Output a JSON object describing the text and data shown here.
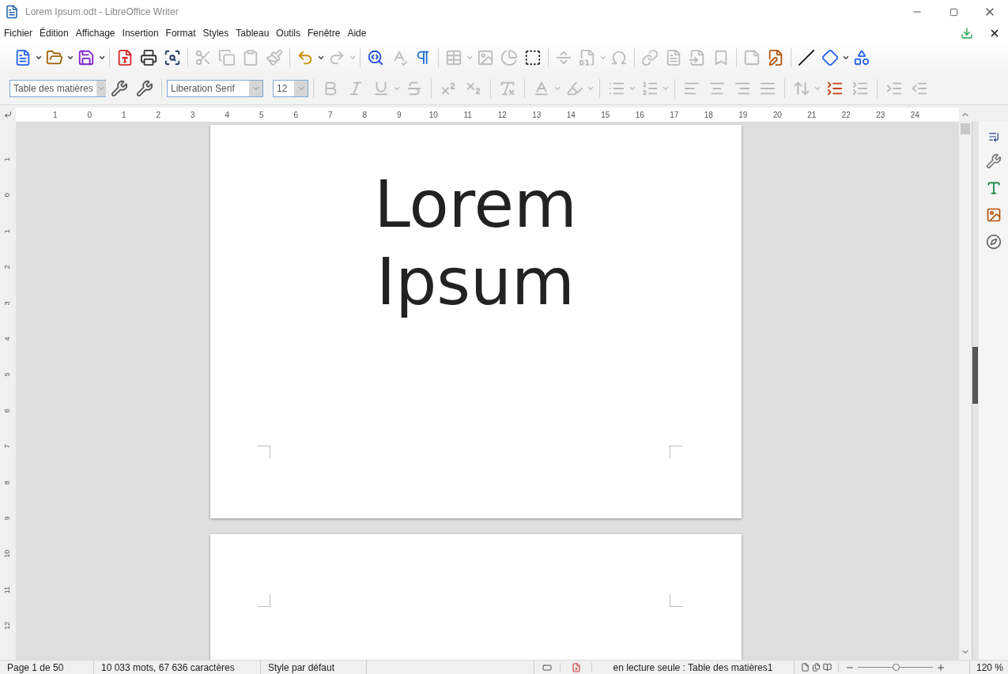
{
  "window": {
    "title": "Lorem Ipsum.odt - LibreOffice Writer"
  },
  "menu": [
    {
      "label": "Fichier"
    },
    {
      "label": "Édition"
    },
    {
      "label": "Affichage"
    },
    {
      "label": "Insertion"
    },
    {
      "label": "Format"
    },
    {
      "label": "Styles"
    },
    {
      "label": "Tableau"
    },
    {
      "label": "Outils"
    },
    {
      "label": "Fenêtre"
    },
    {
      "label": "Aide"
    }
  ],
  "standard_toolbar": [
    {
      "kind": "new",
      "disabled": false,
      "dropdown": true
    },
    {
      "kind": "open",
      "disabled": false,
      "dropdown": true
    },
    {
      "kind": "save",
      "disabled": false,
      "dropdown": true
    },
    {
      "kind": "separator"
    },
    {
      "kind": "pdf",
      "disabled": false,
      "dropdown": false
    },
    {
      "kind": "print",
      "disabled": false,
      "dropdown": false
    },
    {
      "kind": "preview",
      "disabled": false,
      "dropdown": false
    },
    {
      "kind": "separator"
    },
    {
      "kind": "cut",
      "disabled": true,
      "dropdown": false
    },
    {
      "kind": "copy",
      "disabled": true,
      "dropdown": false
    },
    {
      "kind": "paste",
      "disabled": true,
      "dropdown": false
    },
    {
      "kind": "clone",
      "disabled": true,
      "dropdown": false
    },
    {
      "kind": "separator"
    },
    {
      "kind": "undo",
      "disabled": false,
      "dropdown": true
    },
    {
      "kind": "redo",
      "disabled": true,
      "dropdown": true
    },
    {
      "kind": "separator"
    },
    {
      "kind": "find",
      "disabled": false,
      "dropdown": false
    },
    {
      "kind": "spelling",
      "disabled": true,
      "dropdown": false
    },
    {
      "kind": "pilcrow",
      "disabled": false,
      "dropdown": false
    },
    {
      "kind": "separator"
    },
    {
      "kind": "table",
      "disabled": true,
      "dropdown": true
    },
    {
      "kind": "image",
      "disabled": true,
      "dropdown": false
    },
    {
      "kind": "chart",
      "disabled": true,
      "dropdown": false
    },
    {
      "kind": "textbox",
      "disabled": false,
      "dropdown": false
    },
    {
      "kind": "separator"
    },
    {
      "kind": "pagebreak",
      "disabled": true,
      "dropdown": false
    },
    {
      "kind": "field",
      "disabled": true,
      "dropdown": true
    },
    {
      "kind": "omega",
      "disabled": true,
      "dropdown": false
    },
    {
      "kind": "separator"
    },
    {
      "kind": "link",
      "disabled": true,
      "dropdown": false
    },
    {
      "kind": "footnote",
      "disabled": true,
      "dropdown": false
    },
    {
      "kind": "endnote",
      "disabled": true,
      "dropdown": false
    },
    {
      "kind": "bookmark",
      "disabled": true,
      "dropdown": false
    },
    {
      "kind": "separator"
    },
    {
      "kind": "comment",
      "disabled": true,
      "dropdown": false
    },
    {
      "kind": "track",
      "disabled": false,
      "dropdown": false
    },
    {
      "kind": "separator"
    },
    {
      "kind": "line",
      "disabled": false,
      "dropdown": false
    },
    {
      "kind": "shape",
      "disabled": false,
      "dropdown": true
    },
    {
      "kind": "shapes",
      "disabled": false,
      "dropdown": false
    }
  ],
  "formatting_toolbar": {
    "paragraph_style": "Table des matières",
    "font_name": "Liberation Serif",
    "font_size": "12",
    "buttons": [
      {
        "kind": "update-style",
        "disabled": false,
        "dropdown": false
      },
      {
        "kind": "new-style",
        "disabled": false,
        "dropdown": false
      },
      {
        "kind": "bold",
        "disabled": true,
        "dropdown": false
      },
      {
        "kind": "italic",
        "disabled": true,
        "dropdown": false
      },
      {
        "kind": "underline",
        "disabled": true,
        "dropdown": true
      },
      {
        "kind": "strike",
        "disabled": true,
        "dropdown": false
      },
      {
        "kind": "separator"
      },
      {
        "kind": "superscript",
        "disabled": true,
        "dropdown": false
      },
      {
        "kind": "subscript",
        "disabled": true,
        "dropdown": false
      },
      {
        "kind": "separator"
      },
      {
        "kind": "clear",
        "disabled": true,
        "dropdown": false
      },
      {
        "kind": "separator"
      },
      {
        "kind": "fontcolor",
        "disabled": true,
        "dropdown": true
      },
      {
        "kind": "highlight",
        "disabled": true,
        "dropdown": true
      },
      {
        "kind": "separator"
      },
      {
        "kind": "bullets",
        "disabled": true,
        "dropdown": true
      },
      {
        "kind": "numbering",
        "disabled": true,
        "dropdown": true
      },
      {
        "kind": "separator"
      },
      {
        "kind": "align-left",
        "disabled": true,
        "dropdown": false
      },
      {
        "kind": "align-center",
        "disabled": true,
        "dropdown": false
      },
      {
        "kind": "align-right",
        "disabled": true,
        "dropdown": false
      },
      {
        "kind": "justify",
        "disabled": true,
        "dropdown": false
      },
      {
        "kind": "separator"
      },
      {
        "kind": "spacing",
        "disabled": true,
        "dropdown": true
      },
      {
        "kind": "para-increase",
        "disabled": false,
        "dropdown": false
      },
      {
        "kind": "para-decrease",
        "disabled": true,
        "dropdown": false
      },
      {
        "kind": "separator"
      },
      {
        "kind": "indent",
        "disabled": true,
        "dropdown": false
      },
      {
        "kind": "outdent",
        "disabled": true,
        "dropdown": false
      }
    ]
  },
  "ruler": {
    "labels": [
      "1",
      "0",
      "1",
      "2",
      "3",
      "4",
      "5",
      "6",
      "7",
      "8",
      "9",
      "10",
      "11",
      "12",
      "13",
      "14",
      "15",
      "16",
      "17",
      "18",
      "19",
      "20",
      "21",
      "22",
      "23",
      "24"
    ]
  },
  "vertical_ruler": {
    "labels": [
      "1",
      "0",
      "1",
      "2",
      "3",
      "4",
      "5",
      "6",
      "7",
      "8",
      "9",
      "10",
      "11",
      "12"
    ]
  },
  "document": {
    "pages": [
      {
        "kind": "title",
        "text": "Lorem Ipsum"
      },
      {
        "kind": "blank"
      }
    ]
  },
  "status_bar": {
    "page": "Page 1 de 50",
    "words": "10 033 mots, 67 636 caractères",
    "page_style": "Style par défaut",
    "mode": "en lecture seule : Table des matières1",
    "zoom": "120 %",
    "zoom_slider": {
      "level": 0.5
    }
  }
}
